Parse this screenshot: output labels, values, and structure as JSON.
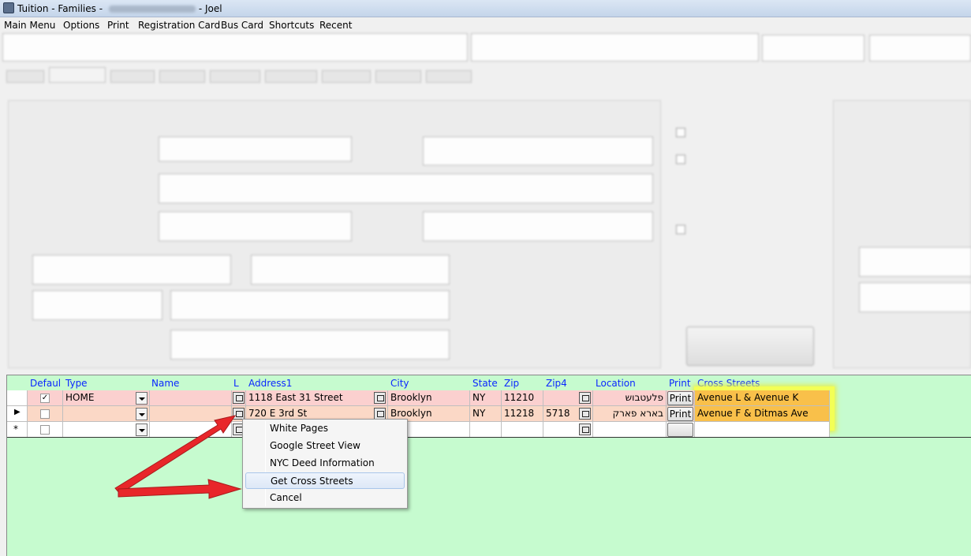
{
  "window": {
    "title_prefix": "Tuition - Families - ",
    "title_suffix": "- Joel"
  },
  "menu": [
    "Main Menu",
    "Options",
    "Print",
    "Registration Card",
    "Bus Card",
    "Shortcuts",
    "Recent"
  ],
  "grid": {
    "headers": [
      "Defaul",
      "Type",
      "Name",
      "L",
      "Address1",
      "City",
      "State",
      "Zip",
      "Zip4",
      "Location",
      "Print",
      "Cross Streets"
    ],
    "rows": [
      {
        "default": true,
        "type": "HOME",
        "name": "",
        "address1": "1118 East 31 Street",
        "city": "Brooklyn",
        "state": "NY",
        "zip": "11210",
        "zip4": "",
        "location": "פלעטבוש",
        "print": "Print",
        "cross_streets": "Avenue L & Avenue K"
      },
      {
        "default": false,
        "type": "",
        "name": "",
        "address1": "720 E 3rd St",
        "city": "Brooklyn",
        "state": "NY",
        "zip": "11218",
        "zip4": "5718",
        "location": "בארא פארק",
        "print": "Print",
        "cross_streets": "Avenue F & Ditmas Ave"
      }
    ],
    "new_row_marker": "*",
    "current_row_marker": "▶"
  },
  "context_menu": {
    "items": [
      "White Pages",
      "Google Street View",
      "NYC Deed Information",
      "Get Cross Streets",
      "Cancel"
    ],
    "highlighted": "Get Cross Streets"
  },
  "colors": {
    "grid_bg": "#c6fbcf",
    "row1": "#fbd0cf",
    "row2": "#fbd8c6",
    "cross_street_fill": "#f9c04a",
    "highlight": "#f3ff56",
    "header_text": "#0b27ff",
    "arrow": "#e8262a"
  }
}
